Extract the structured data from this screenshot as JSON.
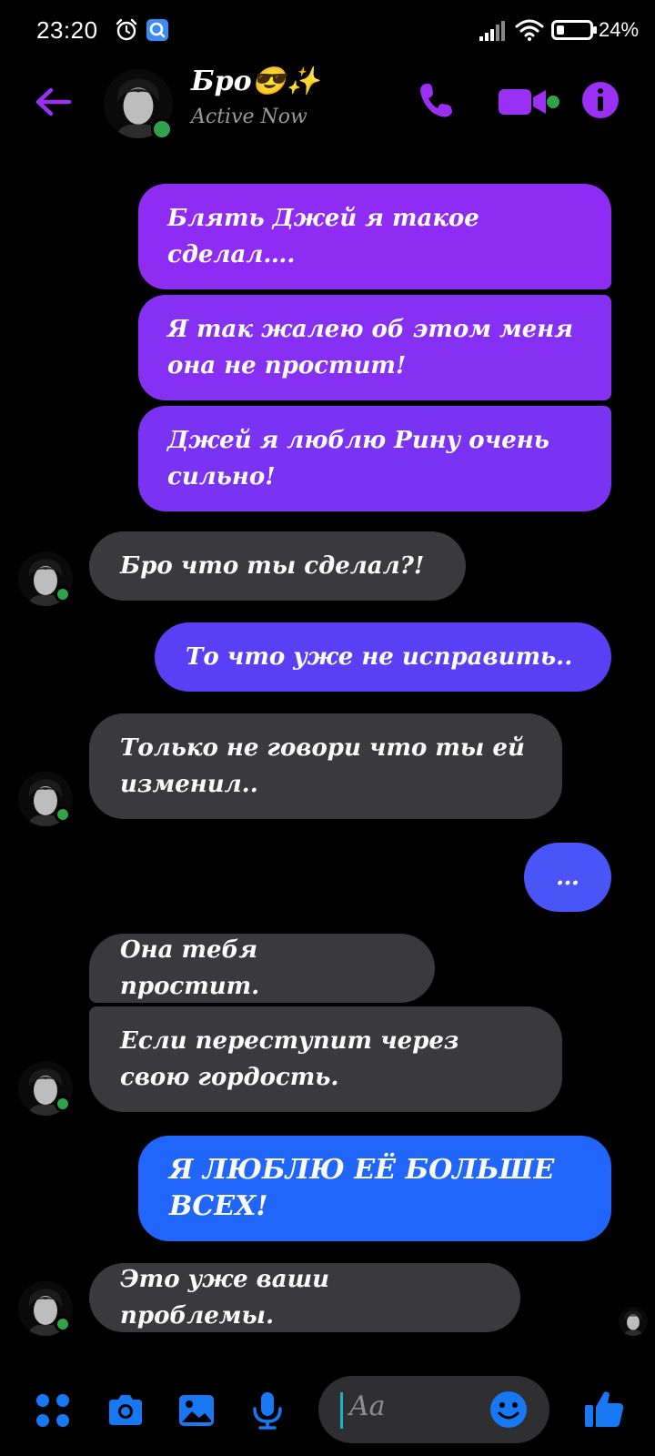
{
  "status_bar": {
    "time": "23:20",
    "battery_percent": "24%",
    "battery_level": 0.24
  },
  "header": {
    "contact_name": "Бро😎✨",
    "contact_status": "Active Now"
  },
  "messages": [
    {
      "direction": "outgoing",
      "text": "Блять Джей я такое сделал…."
    },
    {
      "direction": "outgoing",
      "text": "Я так жалею об этом меня она не простит!"
    },
    {
      "direction": "outgoing",
      "text": "Джей я люблю Рину очень сильно!"
    },
    {
      "direction": "incoming",
      "text": "Бро что ты сделал?!"
    },
    {
      "direction": "outgoing",
      "text": "То что уже не исправить.."
    },
    {
      "direction": "incoming",
      "text": "Только не говори что ты ей изменил.."
    },
    {
      "direction": "outgoing",
      "text": "…"
    },
    {
      "direction": "incoming",
      "text": "Она тебя простит."
    },
    {
      "direction": "incoming",
      "text": "Если переступит через свою гордость."
    },
    {
      "direction": "outgoing",
      "text": "Я ЛЮБЛЮ ЕЁ БОЛЬШЕ ВСЕХ!"
    },
    {
      "direction": "incoming",
      "text": "Это уже ваши проблемы."
    }
  ],
  "composer": {
    "placeholder": "Aa"
  },
  "colors": {
    "accent": "#9b30f5",
    "outgoing_top": "#8a2cf0",
    "outgoing_bottom": "#1f6bff",
    "incoming": "#3a3a3c",
    "composer_icons": "#1877f2",
    "online": "#31a24c"
  }
}
